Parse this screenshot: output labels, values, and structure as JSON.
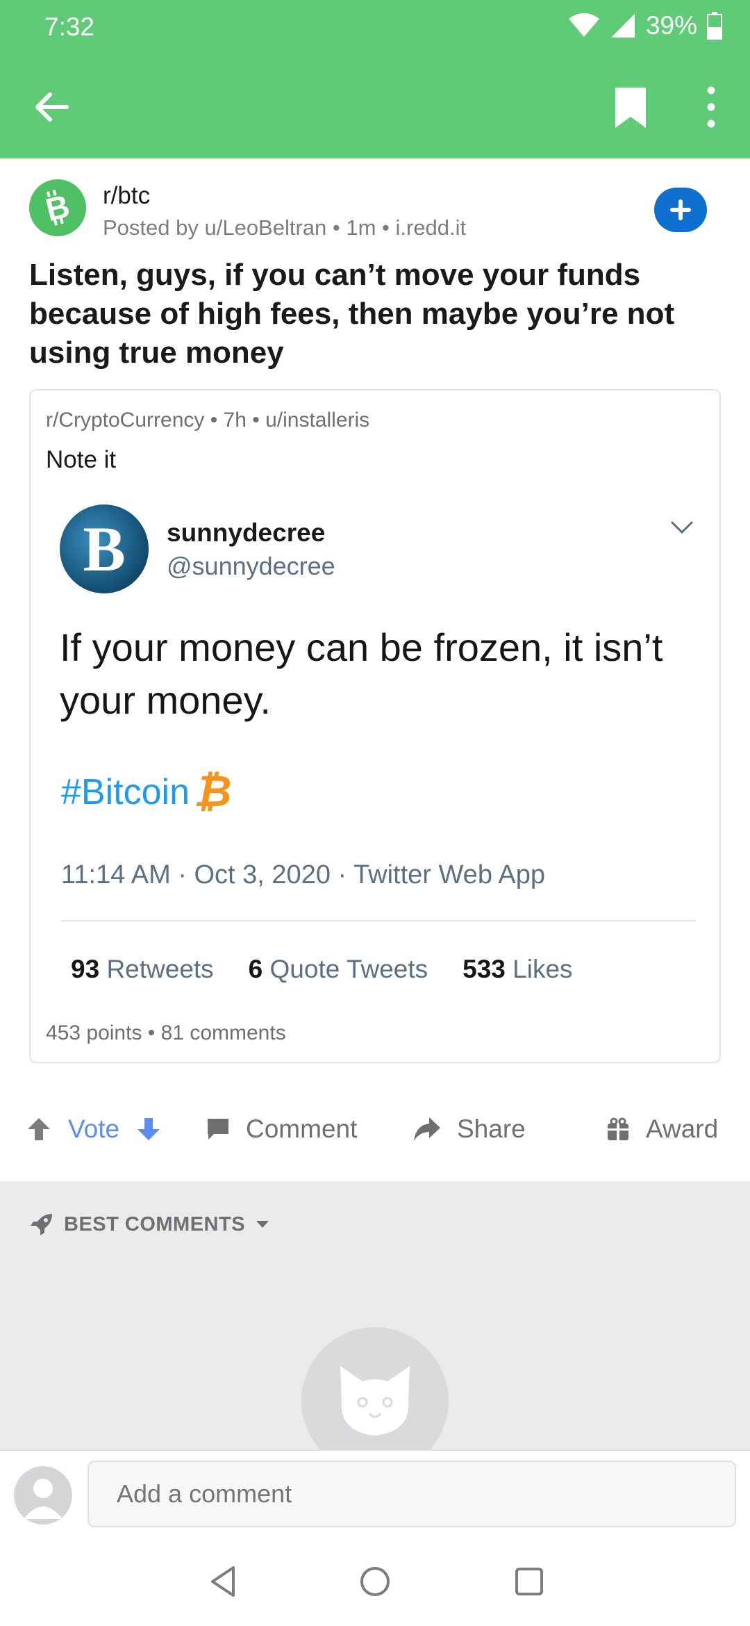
{
  "status": {
    "time": "7:32",
    "battery": "39%"
  },
  "post": {
    "subreddit": "r/btc",
    "meta": "Posted by u/LeoBeltran • 1m • i.redd.it",
    "title": "Listen, guys, if you can’t move your funds because of high fees, then maybe you’re not using true money"
  },
  "crosspost": {
    "meta": "r/CryptoCurrency • 7h • u/installeris",
    "title": "Note it",
    "footer": "453 points • 81 comments",
    "tweet": {
      "avatar_letter": "B",
      "name": "sunnydecree",
      "handle": "@sunnydecree",
      "text": "If your money can be frozen, it isn’t your money.",
      "hashtag": "#Bitcoin",
      "hashtag_glyph": "₿",
      "date": "11:14 AM · Oct 3, 2020 · Twitter Web App",
      "stats": {
        "retweets_count": "93",
        "retweets_label": "Retweets",
        "quotes_count": "6",
        "quotes_label": "Quote Tweets",
        "likes_count": "533",
        "likes_label": "Likes"
      }
    }
  },
  "actions": {
    "vote": "Vote",
    "comment": "Comment",
    "share": "Share",
    "award": "Award"
  },
  "comments": {
    "sort_label": "BEST COMMENTS",
    "input_placeholder": "Add a comment"
  },
  "colors": {
    "app_bar": "#5fcb77",
    "accent_blue": "#0e6fcf",
    "vote_blue": "#5c8ef0",
    "twitter_blue": "#1d9bf0",
    "bitcoin_orange": "#f7931a"
  },
  "icons": [
    "back-arrow-icon",
    "bookmark-icon",
    "more-vert-icon",
    "bitcoin-logo-icon",
    "plus-icon",
    "chevron-down-icon",
    "upvote-icon",
    "downvote-icon",
    "comment-icon",
    "share-icon",
    "award-icon",
    "rocket-icon",
    "caret-down-icon",
    "snoo-cat-icon",
    "user-avatar-icon",
    "nav-back-icon",
    "nav-home-icon",
    "nav-recents-icon",
    "wifi-icon",
    "signal-icon",
    "battery-icon"
  ]
}
